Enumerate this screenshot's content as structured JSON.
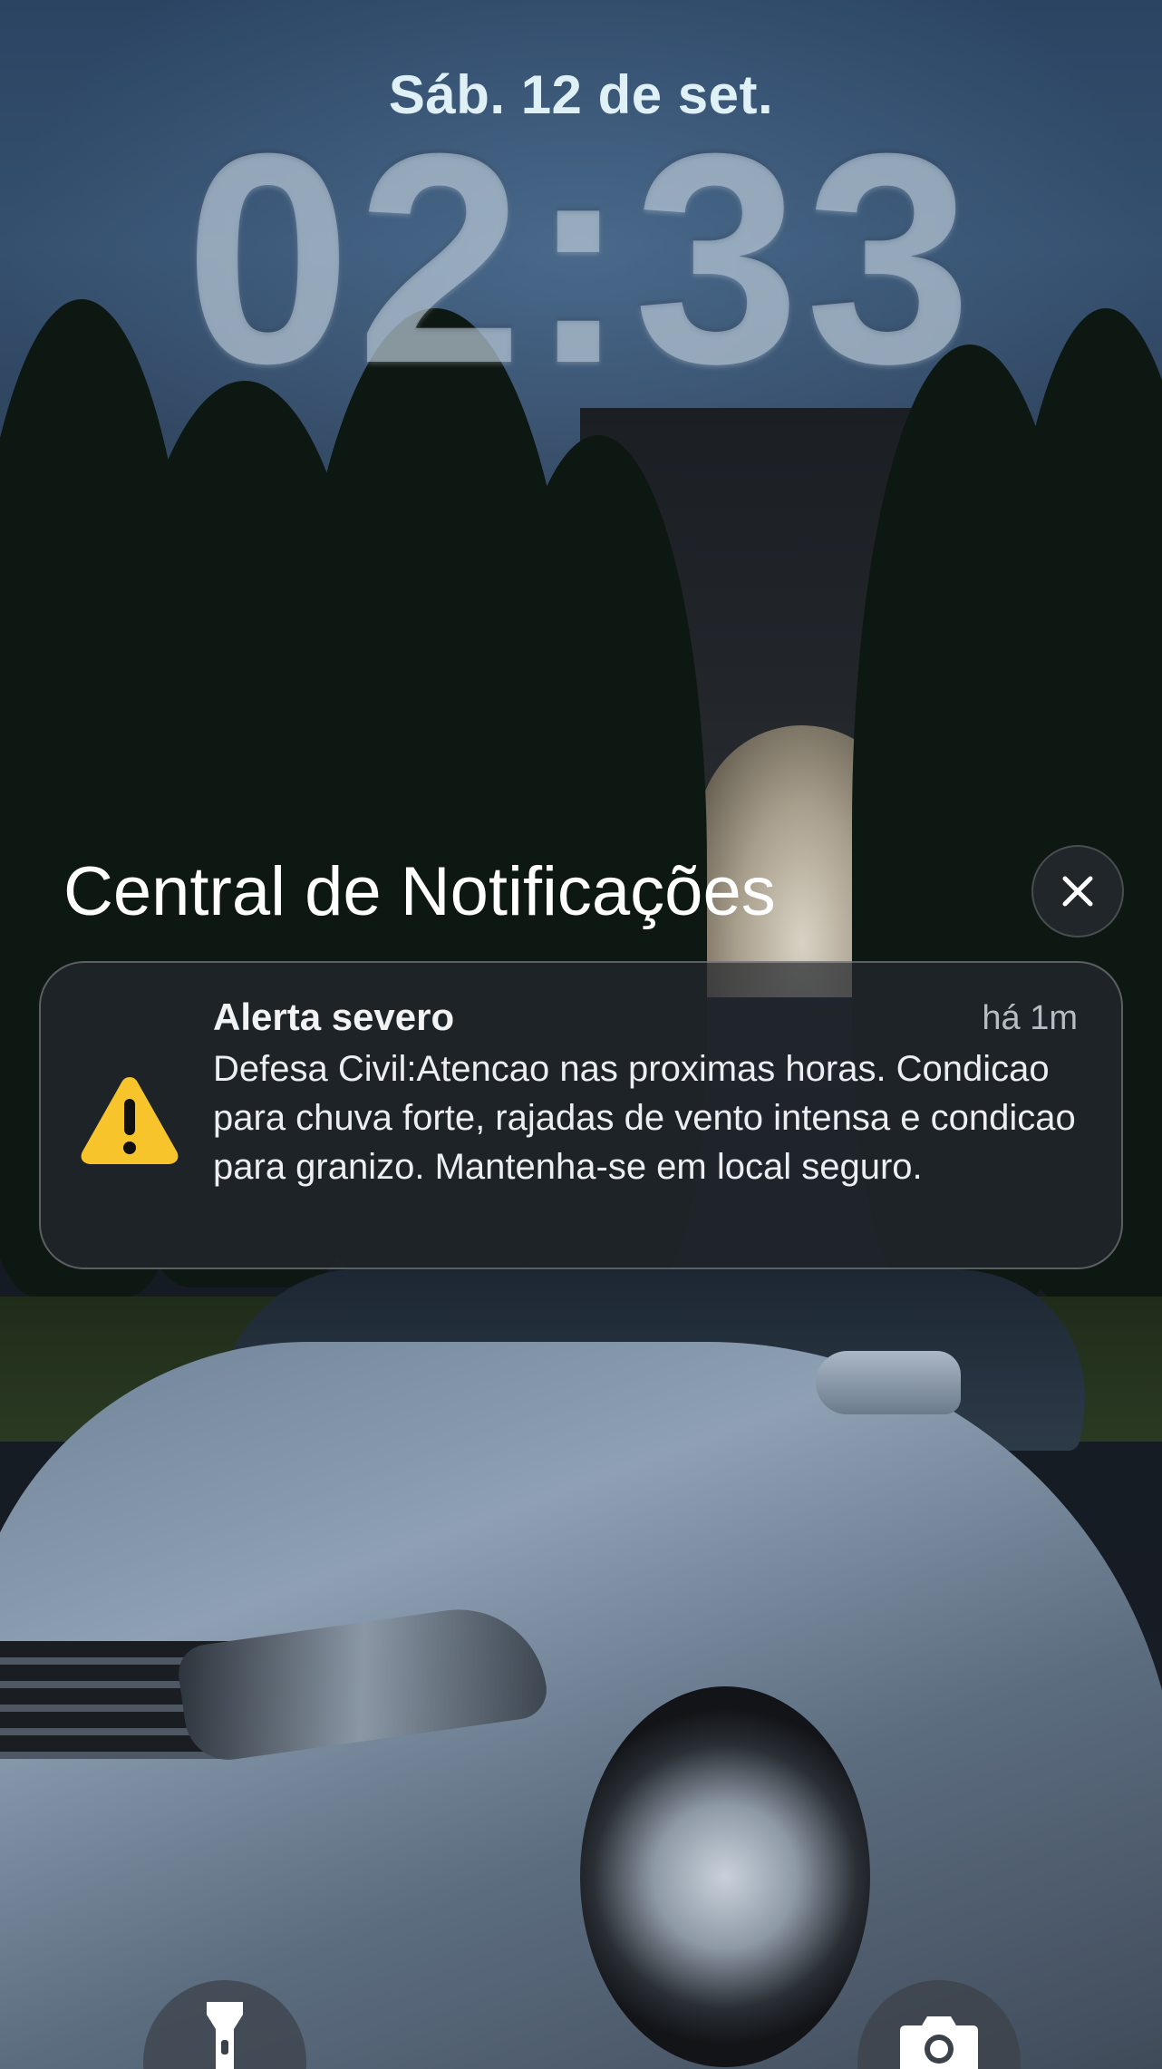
{
  "lock_screen": {
    "date": "Sáb. 12 de set.",
    "time": "02:33"
  },
  "notification_center": {
    "title": "Central de Notificações",
    "close_icon": "close-icon"
  },
  "notifications": [
    {
      "app_icon": "warning-triangle-icon",
      "title": "Alerta severo",
      "time": "há 1m",
      "body": "Defesa Civil:Atencao nas proximas horas. Condicao para chuva forte, rajadas de vento intensa e condicao para granizo. Mantenha-se em local seguro."
    }
  ],
  "quick_actions": {
    "left_icon": "flashlight-icon",
    "right_icon": "camera-icon"
  },
  "colors": {
    "warning_yellow": "#f7c52b",
    "text_white": "#ffffff"
  }
}
